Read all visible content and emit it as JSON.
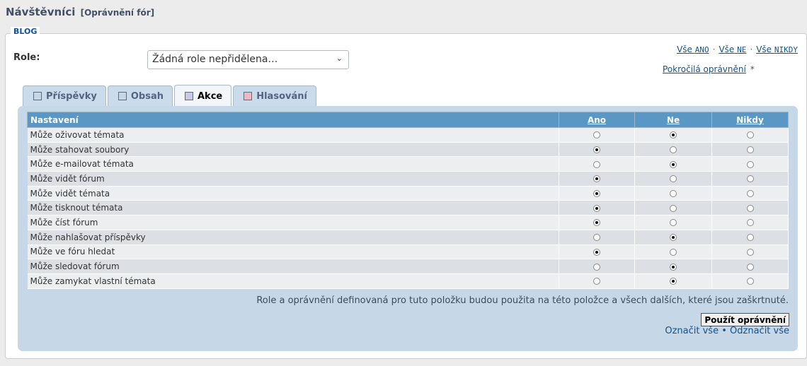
{
  "header": {
    "title": "Návštěvníci",
    "subtitle": "[Oprávnění fór]"
  },
  "fieldset": {
    "legend": "BLOG"
  },
  "role": {
    "label": "Role:",
    "selected": "Žádná role nepřidělena…"
  },
  "quick_links": {
    "all_yes_prefix": "Vše",
    "all_yes_value": "ANO",
    "all_no_prefix": "Vše",
    "all_no_value": "NE",
    "all_never_prefix": "Vše",
    "all_never_value": "NIKDY",
    "separator": "·",
    "advanced": "Pokročilá oprávnění",
    "advanced_star": "*"
  },
  "tabs": [
    {
      "label": "Příspěvky",
      "color": "#c7d7ea",
      "active": false
    },
    {
      "label": "Obsah",
      "color": "#c7d7ea",
      "active": false
    },
    {
      "label": "Akce",
      "color": "#c9c9e6",
      "active": true
    },
    {
      "label": "Hlasování",
      "color": "#f0b6c4",
      "active": false
    }
  ],
  "table": {
    "headers": {
      "setting": "Nastavení",
      "yes": "Ano",
      "no": "Ne",
      "never": "Nikdy"
    },
    "rows": [
      {
        "label": "Může oživovat témata",
        "value": "no"
      },
      {
        "label": "Může stahovat soubory",
        "value": "yes"
      },
      {
        "label": "Může e-mailovat témata",
        "value": "no"
      },
      {
        "label": "Může vidět fórum",
        "value": "yes"
      },
      {
        "label": "Může vidět témata",
        "value": "yes"
      },
      {
        "label": "Může tisknout témata",
        "value": "yes"
      },
      {
        "label": "Může číst fórum",
        "value": "yes"
      },
      {
        "label": "Může nahlašovat příspěvky",
        "value": "no"
      },
      {
        "label": "Může ve fóru hledat",
        "value": "yes"
      },
      {
        "label": "Může sledovat fórum",
        "value": "no"
      },
      {
        "label": "Může zamykat vlastní témata",
        "value": "no"
      }
    ]
  },
  "note": "Role a oprávnění definovaná pro tuto položku budou použita na této položce a všech dalších, které jsou zaškrtnuté.",
  "apply_button": "Použít oprávnění",
  "mark_all": "Označit vše",
  "mark_separator": "•",
  "unmark_all": "Odznačit vše",
  "colors": {
    "accent": "#105289",
    "table_header": "#5a97c5",
    "panel_bg": "#c6d8e8"
  }
}
